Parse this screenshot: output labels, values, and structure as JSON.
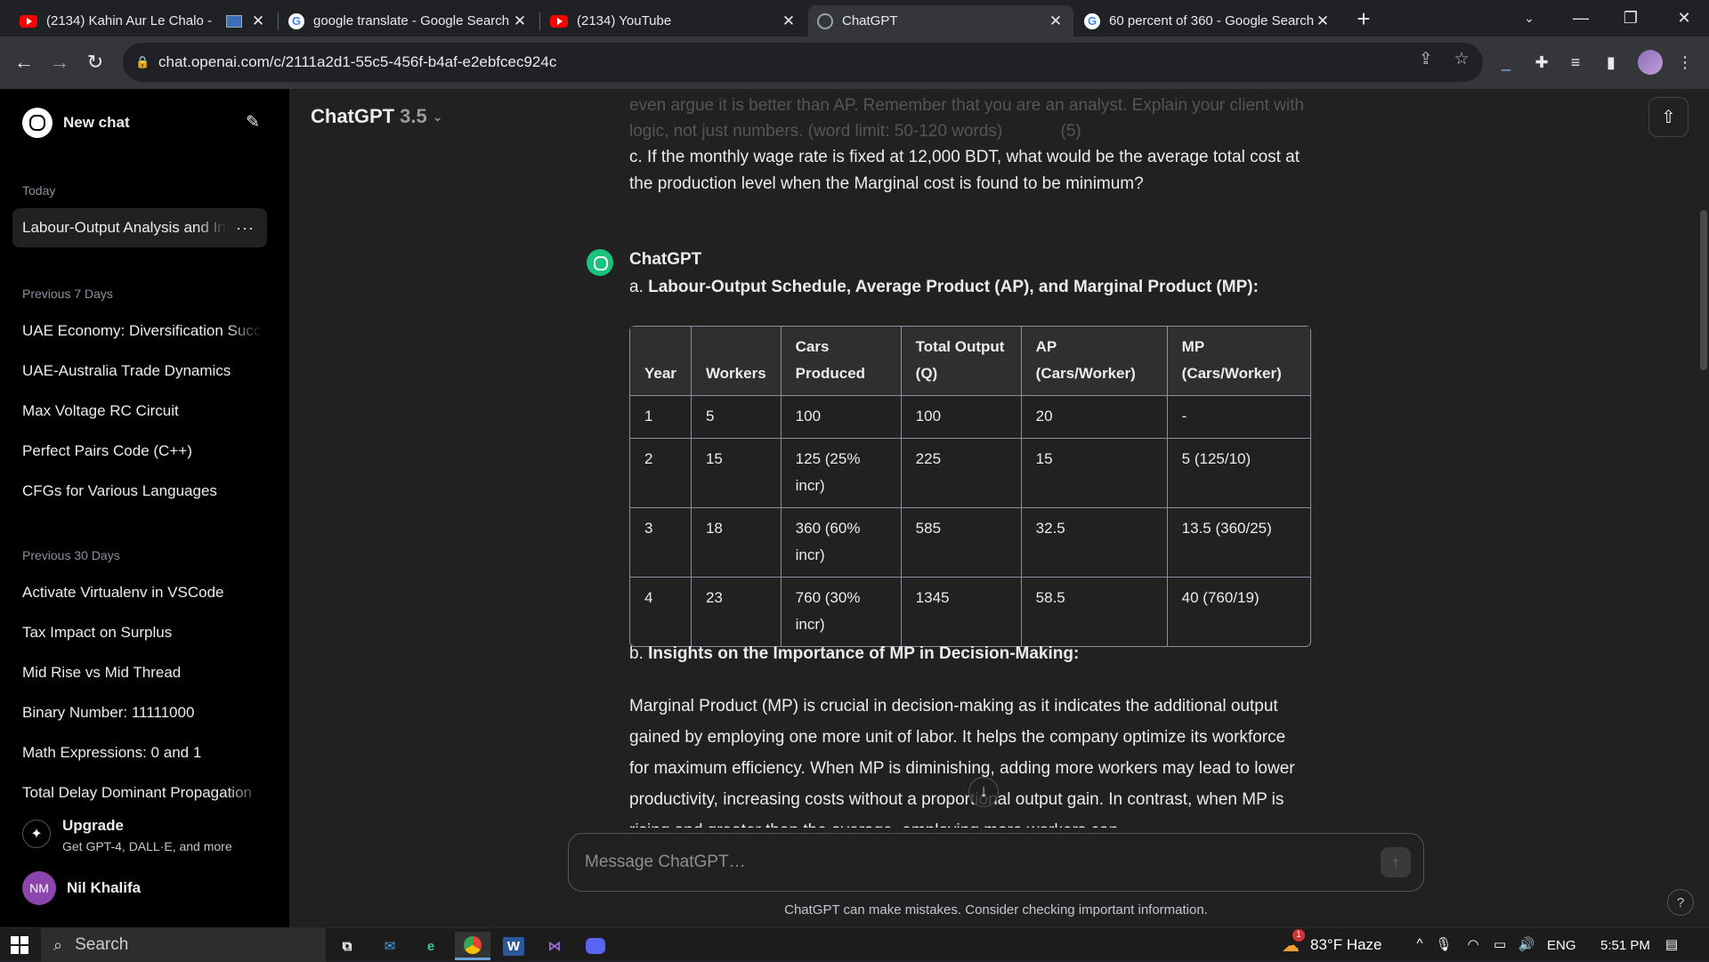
{
  "browser": {
    "tabs": [
      {
        "title": "(2134) Kahin Aur Le Chalo -",
        "icon": "youtube-icon"
      },
      {
        "title": "google translate - Google Search",
        "icon": "google-icon"
      },
      {
        "title": "(2134) YouTube",
        "icon": "youtube-icon"
      },
      {
        "title": "ChatGPT",
        "icon": "chatgpt-icon",
        "active": true
      },
      {
        "title": "60 percent of 360 - Google Search",
        "icon": "google-icon"
      }
    ],
    "url": "chat.openai.com/c/2111a2d1-55c5-456f-b4af-e2ebfcec924c"
  },
  "sidebar": {
    "new_chat": "New chat",
    "sections": [
      {
        "title": "Today",
        "items": [
          "Labour-Output Analysis and Insights"
        ]
      },
      {
        "title": "Previous 7 Days",
        "items": [
          "UAE Economy: Diversification Success",
          "UAE-Australia Trade Dynamics",
          "Max Voltage RC Circuit",
          "Perfect Pairs Code (C++)",
          "CFGs for Various Languages"
        ]
      },
      {
        "title": "Previous 30 Days",
        "items": [
          "Activate Virtualenv in VSCode",
          "Tax Impact on Surplus",
          "Mid Rise vs Mid Thread",
          "Binary Number: 11111000",
          "Math Expressions: 0 and 1",
          "Total Delay Dominant Propagation"
        ]
      }
    ],
    "upgrade": {
      "title": "Upgrade",
      "subtitle": "Get GPT-4, DALL·E, and more"
    },
    "user": {
      "initials": "NM",
      "name": "Nil Khalifa"
    }
  },
  "header": {
    "model": "ChatGPT",
    "version": "3.5"
  },
  "conversation": {
    "faded_text": "even argue it is better than AP. Remember that you are an analyst. Explain your client with logic, not just numbers. (word limit: 50-120 words)",
    "faded_marks": "(5)",
    "question_c": "c.    If the monthly wage rate is fixed at 12,000 BDT, what would be the average total cost at the production level when the Marginal cost is found to be minimum?",
    "assistant_name": "ChatGPT",
    "heading_a_prefix": "a. ",
    "heading_a": "Labour-Output Schedule, Average Product (AP), and Marginal Product (MP):",
    "table": {
      "headers": [
        "Year",
        "Workers",
        "Cars Produced",
        "Total Output (Q)",
        "AP (Cars/Worker)",
        "MP (Cars/Worker)"
      ],
      "rows": [
        [
          "1",
          "5",
          "100",
          "100",
          "20",
          "-"
        ],
        [
          "2",
          "15",
          "125 (25% incr)",
          "225",
          "15",
          "5 (125/10)"
        ],
        [
          "3",
          "18",
          "360 (60% incr)",
          "585",
          "32.5",
          "13.5 (360/25)"
        ],
        [
          "4",
          "23",
          "760 (30% incr)",
          "1345",
          "58.5",
          "40 (760/19)"
        ]
      ]
    },
    "heading_b_prefix": "b. ",
    "heading_b": "Insights on the Importance of MP in Decision-Making:",
    "paragraph": "Marginal Product (MP) is crucial in decision-making as it indicates the additional output gained by employing one more unit of labor. It helps the company optimize its workforce for maximum efficiency. When MP is diminishing, adding more workers may lead to lower productivity, increasing costs without a proportional output gain. In contrast, when MP is rising and greater than the average, employing more workers can"
  },
  "composer": {
    "placeholder": "Message ChatGPT…"
  },
  "disclaimer": "ChatGPT can make mistakes. Consider checking important information.",
  "taskbar": {
    "search": "Search",
    "weather": "83°F  Haze",
    "weather_badge": "1",
    "language": "ENG",
    "time": "5:51 PM"
  }
}
